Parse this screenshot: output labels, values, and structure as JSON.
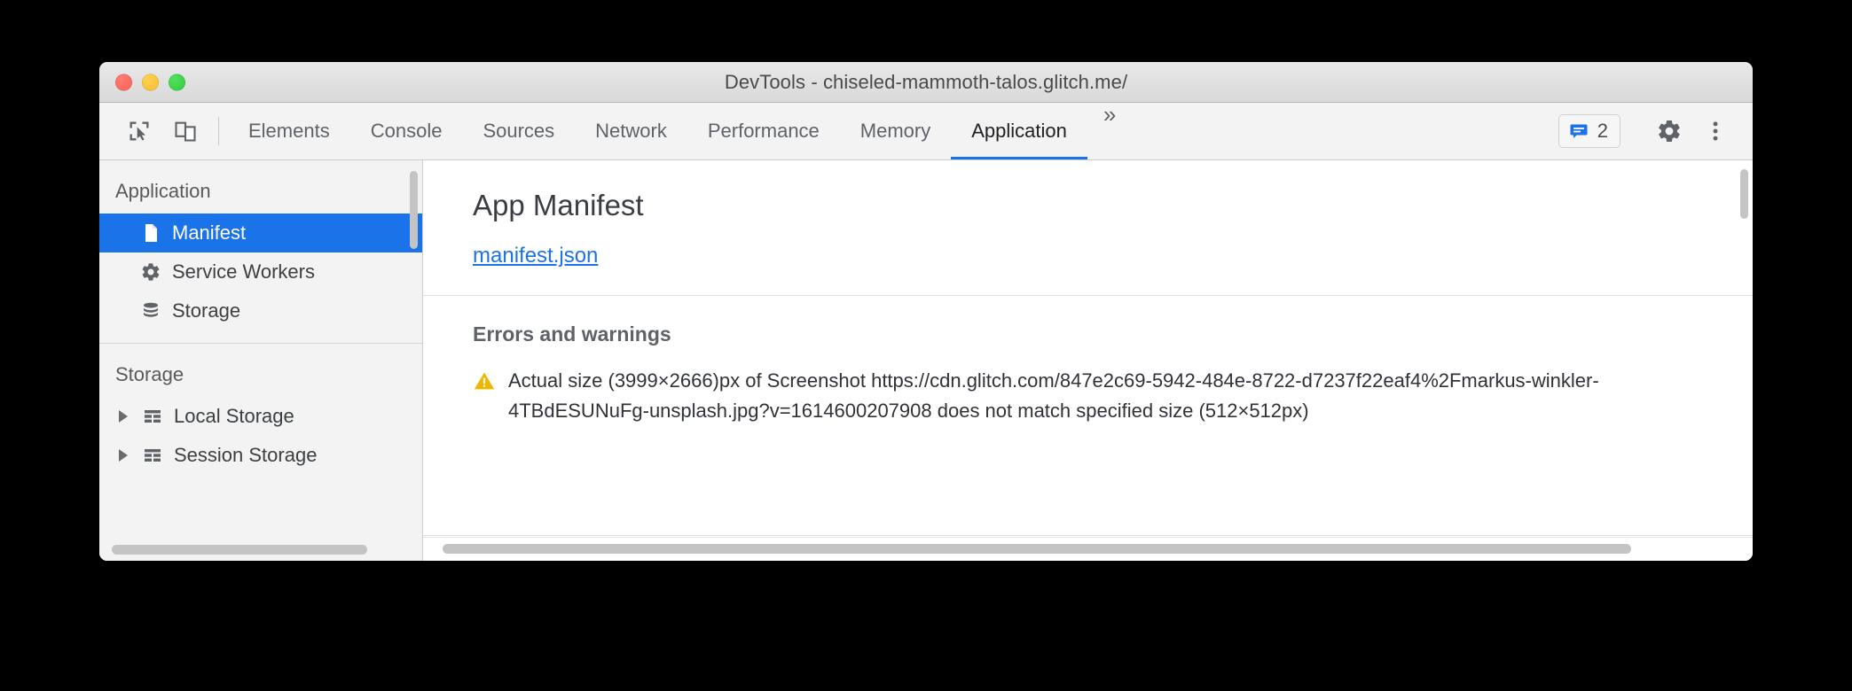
{
  "window": {
    "title": "DevTools - chiseled-mammoth-talos.glitch.me/",
    "traffic_lights": [
      "close",
      "minimize",
      "zoom"
    ]
  },
  "toolbar": {
    "inspect_icon": "inspect-element-icon",
    "device_icon": "device-toolbar-icon",
    "tabs": [
      {
        "label": "Elements",
        "active": false
      },
      {
        "label": "Console",
        "active": false
      },
      {
        "label": "Sources",
        "active": false
      },
      {
        "label": "Network",
        "active": false
      },
      {
        "label": "Performance",
        "active": false
      },
      {
        "label": "Memory",
        "active": false
      },
      {
        "label": "Application",
        "active": true
      }
    ],
    "overflow_label": "»",
    "issues": {
      "icon": "issues-message-icon",
      "count": "2"
    },
    "settings_icon": "gear-icon",
    "more_icon": "three-dots-vertical-icon",
    "accent_color": "#1a73e8"
  },
  "sidebar": {
    "sections": [
      {
        "title": "Application",
        "items": [
          {
            "label": "Manifest",
            "icon": "document-icon",
            "selected": true
          },
          {
            "label": "Service Workers",
            "icon": "gear-icon",
            "selected": false
          },
          {
            "label": "Storage",
            "icon": "database-icon",
            "selected": false
          }
        ]
      },
      {
        "title": "Storage",
        "items": [
          {
            "label": "Local Storage",
            "icon": "table-grid-icon",
            "expandable": true
          },
          {
            "label": "Session Storage",
            "icon": "table-grid-icon",
            "expandable": true
          }
        ]
      }
    ]
  },
  "main": {
    "heading": "App Manifest",
    "manifest_link": "manifest.json",
    "errors_heading": "Errors and warnings",
    "warnings": [
      {
        "icon": "warning-triangle-icon",
        "color": "#f2b600",
        "text": "Actual size (3999×2666)px of Screenshot https://cdn.glitch.com/847e2c69-5942-484e-8722-d7237f22eaf4%2Fmarkus-winkler-4TBdESUNuFg-unsplash.jpg?v=1614600207908 does not match specified size (512×512px)"
      }
    ]
  }
}
